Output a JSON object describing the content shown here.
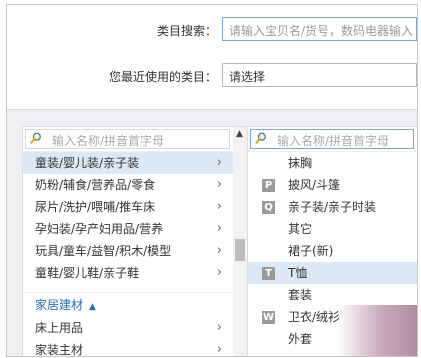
{
  "form": {
    "search_label": "类目搜索：",
    "search_placeholder": "请输入宝贝名/货号，数码电器输入",
    "recent_label": "您最近使用的类目：",
    "recent_value": "请选择"
  },
  "left_column": {
    "search_placeholder": "输入名称/拼音首字母",
    "items": [
      {
        "label": "童装/婴儿装/亲子装",
        "chevron": "›"
      },
      {
        "label": "奶粉/辅食/营养品/零食",
        "chevron": "›"
      },
      {
        "label": "尿片/洗护/喂哺/推车床",
        "chevron": "›"
      },
      {
        "label": "孕妇装/孕产妇用品/营养",
        "chevron": "›"
      },
      {
        "label": "玩具/童车/益智/积木/模型",
        "chevron": "›"
      },
      {
        "label": "童鞋/婴儿鞋/亲子鞋",
        "chevron": "›"
      }
    ],
    "group": {
      "label": "家居建材",
      "items": [
        {
          "label": "床上用品",
          "chevron": "›"
        },
        {
          "label": "家装主材",
          "chevron": "›"
        }
      ]
    }
  },
  "right_column": {
    "search_placeholder": "输入名称/拼音首字母",
    "items": [
      {
        "letter": "",
        "label": "抹胸"
      },
      {
        "letter": "P",
        "label": "披风/斗篷"
      },
      {
        "letter": "Q",
        "label": "亲子装/亲子时装"
      },
      {
        "letter": "",
        "label": "其它"
      },
      {
        "letter": "",
        "label": "裙子(新)"
      },
      {
        "letter": "T",
        "label": "T恤"
      },
      {
        "letter": "",
        "label": "套装"
      },
      {
        "letter": "W",
        "label": "卫衣/绒衫"
      },
      {
        "letter": "",
        "label": "外套"
      }
    ]
  },
  "colors": {
    "accent": "#2b6cb4",
    "selected_bg": "#dbe8f6",
    "panel_bg": "#eef0f3"
  },
  "icons": {
    "search": "magnifier-icon",
    "scroll_up": "triangle-up-icon",
    "chevron": "chevron-right-icon"
  }
}
